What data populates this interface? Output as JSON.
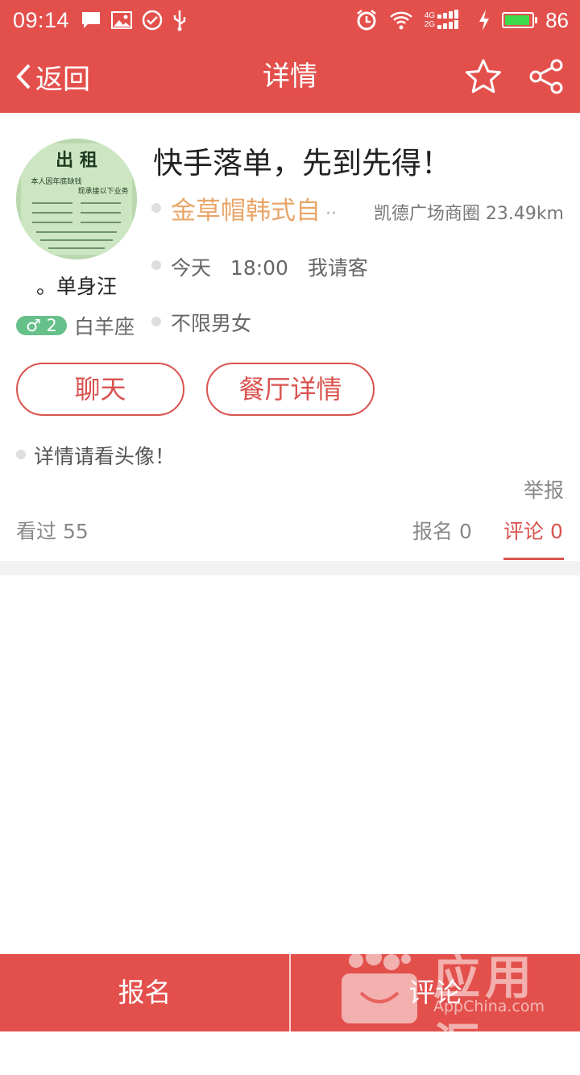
{
  "status_bar": {
    "time": "09:14",
    "network_4g": "4G",
    "network_2g": "2G",
    "battery": "86"
  },
  "header": {
    "back_label": "返回",
    "title": "详情"
  },
  "host": {
    "avatar_text": {
      "title": "出 租",
      "subtitle": "本人因年底缺钱",
      "line2": "现承接以下业务"
    },
    "nickname": "。单身汪",
    "gender_symbol": "♂",
    "age": "2",
    "zodiac": "白羊座"
  },
  "event": {
    "title": "快手落单，先到先得！",
    "restaurant": "金草帽韩式自",
    "restaurant_ellipsis": "··",
    "location": "凯德广场商圈 23.49km",
    "day": "今天",
    "time": "18:00",
    "payment": "我请客",
    "gender_requirement": "不限男女",
    "description": "详情请看头像！"
  },
  "actions": {
    "chat_label": "聊天",
    "restaurant_detail_label": "餐厅详情",
    "report_label": "举报"
  },
  "stats": {
    "views_label": "看过 55",
    "signup_tab_label": "报名 0",
    "comment_tab_label": "评论 0"
  },
  "bottom": {
    "signup_label": "报名",
    "comment_label": "评论"
  },
  "watermark": {
    "cn": "应用汇",
    "en": "AppChina.com"
  },
  "colors": {
    "brand": "#e3504c",
    "accent_text": "#d9534f",
    "restaurant": "#e9a66a",
    "gender_badge": "#66c08a"
  }
}
